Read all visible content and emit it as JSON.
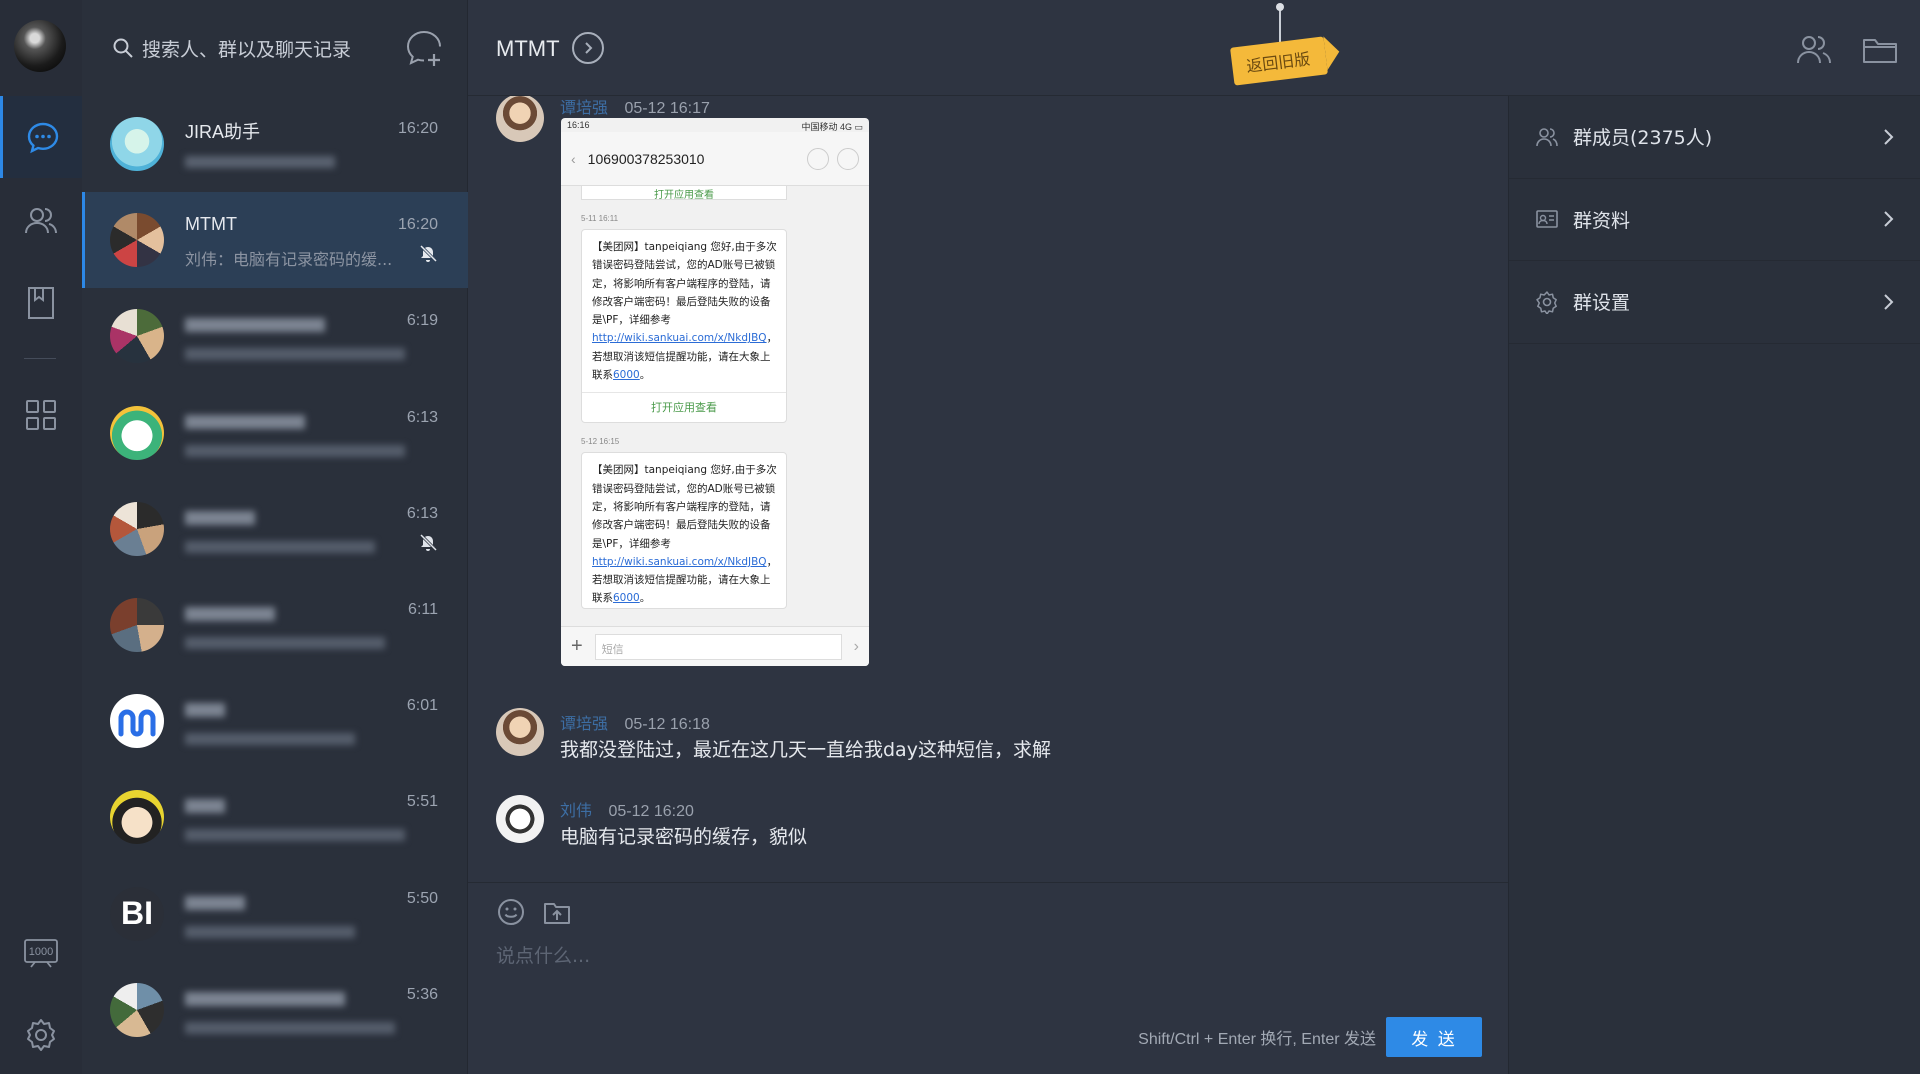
{
  "sidebar": {
    "items": [
      {
        "name": "chat-icon"
      },
      {
        "name": "contacts-icon"
      },
      {
        "name": "document-icon"
      },
      {
        "name": "apps-icon"
      },
      {
        "name": "calendar-1000-icon",
        "label": "1000"
      },
      {
        "name": "settings-icon"
      }
    ]
  },
  "search": {
    "placeholder": "搜索人、群以及聊天记录"
  },
  "conversations": [
    {
      "name": "JIRA助手",
      "time": "16:20",
      "preview": "",
      "active": false
    },
    {
      "name": "MTMT",
      "time": "16:20",
      "preview": "刘伟：电脑有记录密码的缓...",
      "active": true,
      "muted": true
    },
    {
      "name": "",
      "time": "6:19",
      "preview": ""
    },
    {
      "name": "",
      "time": "6:13",
      "preview": ""
    },
    {
      "name": "",
      "time": "6:13",
      "preview": "",
      "muted": true
    },
    {
      "name": "",
      "time": "6:11",
      "preview": ""
    },
    {
      "name": "",
      "time": "6:01",
      "preview": ""
    },
    {
      "name": "",
      "time": "5:51",
      "preview": ""
    },
    {
      "name": "",
      "time": "5:50",
      "preview": ""
    },
    {
      "name": "",
      "time": "5:36",
      "preview": ""
    }
  ],
  "chat": {
    "title": "MTMT",
    "legacy_tag": "返回旧版",
    "messages": [
      {
        "sender": "谭培强",
        "time": "05-12 16:17",
        "type": "image"
      },
      {
        "sender": "谭培强",
        "time": "05-12 16:18",
        "text": "我都没登陆过，最近在这几天一直给我day这种短信，求解"
      },
      {
        "sender": "刘伟",
        "time": "05-12 16:20",
        "text": "电脑有记录密码的缓存，貌似"
      }
    ],
    "screenshot": {
      "status_time": "16:16",
      "carrier": "中国移动 4G",
      "number": "106900378253010",
      "stub": "打开应用查看",
      "sms": [
        {
          "date": "5-11 16:11",
          "text": "【美团网】tanpeiqiang 您好,由于多次错误密码登陆尝试，您的AD账号已被锁定，将影响所有客户端程序的登陆，请修改客户端密码！最后登陆失败的设备是\\PF，详细参考",
          "link": "http://wiki.sankuai.com/x/NkdJBQ",
          "after": "，若想取消该短信提醒功能，请在大象上联系",
          "contact": "6000",
          "end": "。",
          "action": "打开应用查看"
        },
        {
          "date": "5-12 16:15",
          "text": "【美团网】tanpeiqiang 您好,由于多次错误密码登陆尝试，您的AD账号已被锁定，将影响所有客户端程序的登陆，请修改客户端密码！最后登陆失败的设备是\\PF，详细参考",
          "link": "http://wiki.sankuai.com/x/NkdJBQ",
          "after": "，若想取消该短信提醒功能，请在大象上联系",
          "contact": "6000",
          "end": "。",
          "action": ""
        }
      ],
      "input_placeholder": "短信"
    }
  },
  "composer": {
    "placeholder": "说点什么...",
    "hint": "Shift/Ctrl + Enter 换行, Enter 发送",
    "send_label": "发 送"
  },
  "panel": {
    "rows": [
      {
        "label": "群成员(2375人)",
        "icon": "members-icon"
      },
      {
        "label": "群资料",
        "icon": "profile-card-icon"
      },
      {
        "label": "群设置",
        "icon": "gear-icon"
      }
    ]
  },
  "colors": {
    "accent": "#2e8ae6",
    "background": "#2e3441",
    "sender_name": "#3d6ea4",
    "legacy_tag": "#f4b93a"
  }
}
